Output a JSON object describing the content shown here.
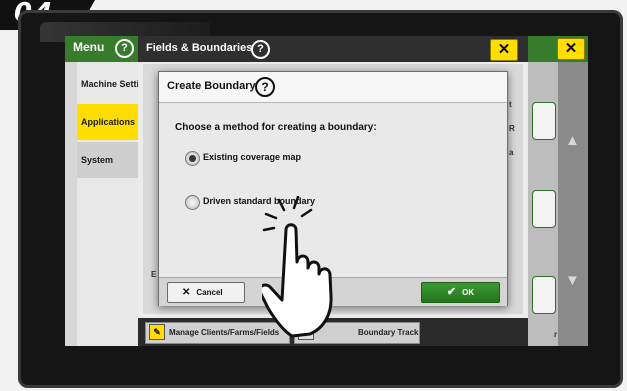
{
  "badge": {
    "text": "04"
  },
  "menu": {
    "title": "Menu",
    "help_icon": "?"
  },
  "sidebar": {
    "items": [
      {
        "label": "Machine Setti"
      },
      {
        "label": "Applications"
      },
      {
        "label": "System"
      }
    ]
  },
  "fields_window": {
    "title": "Fields & Boundaries",
    "help_icon": "?",
    "close_icon": "✕"
  },
  "outer_close": {
    "icon": "✕"
  },
  "under_text": {
    "left_a": "E",
    "right_a": "t",
    "right_b": "R",
    "right_c": "a",
    "right_d": "r"
  },
  "dialog": {
    "title": "Create Boundary",
    "help_icon": "?",
    "prompt": "Choose a method for creating a boundary:",
    "options": [
      {
        "label": "Existing coverage map",
        "selected": true
      },
      {
        "label": "Driven standard boundary",
        "selected": false
      }
    ],
    "cancel_label": "Cancel",
    "cancel_icon": "✕",
    "ok_label": "OK",
    "ok_icon": "✔"
  },
  "bottom_bar": {
    "manage_label": "Manage Clients/Farms/Fields",
    "boundary_track_label": "Boundary Track"
  },
  "colors": {
    "accent_green": "#367c2b",
    "highlight_yellow": "#ffde00",
    "ok_green": "#2e8b26"
  }
}
